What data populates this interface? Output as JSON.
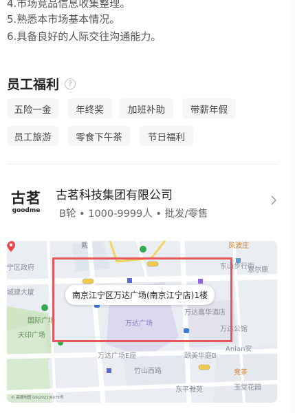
{
  "requirements": [
    "4.市场竞品信息收集整理。",
    "5.熟悉本市场基本情况。",
    "6.具备良好的人际交往沟通能力。"
  ],
  "benefits": {
    "title": "员工福利",
    "help_icon": "?",
    "tags": [
      "五险一金",
      "年终奖",
      "加班补助",
      "带薪年假",
      "员工旅游",
      "零食下午茶",
      "节日福利"
    ]
  },
  "company": {
    "logo_cn": "古茗",
    "logo_en": "goodme",
    "name": "古茗科技集团有限公司",
    "meta": "B轮 • 1000-9999人 • 批发/零售"
  },
  "map": {
    "address": "南京江宁区万达广场(南京江宁店)1楼",
    "copyright": "© 高德地图 GS(2021)6075号",
    "labels": [
      {
        "text": "戴",
        "cls": ""
      },
      {
        "text": "凤波庄",
        "cls": "o"
      },
      {
        "text": "宁区政府",
        "cls": ""
      },
      {
        "text": "东山步行街",
        "cls": ""
      },
      {
        "text": "意尔康",
        "cls": ""
      },
      {
        "text": "城建大厦",
        "cls": ""
      },
      {
        "text": "国际广场",
        "cls": "g"
      },
      {
        "text": "天印广场",
        "cls": "g"
      },
      {
        "text": "万达广场",
        "cls": "p"
      },
      {
        "text": "万达嘉华酒店",
        "cls": ""
      },
      {
        "text": "万达公馆",
        "cls": ""
      },
      {
        "text": "Anlan安",
        "cls": ""
      },
      {
        "text": "万达广场E座",
        "cls": ""
      },
      {
        "text": "颐美华庭B",
        "cls": ""
      },
      {
        "text": "竞茶",
        "cls": "o"
      },
      {
        "text": "竹山西路",
        "cls": ""
      },
      {
        "text": "东平雅苑",
        "cls": ""
      },
      {
        "text": "玉堂花园",
        "cls": ""
      }
    ]
  }
}
